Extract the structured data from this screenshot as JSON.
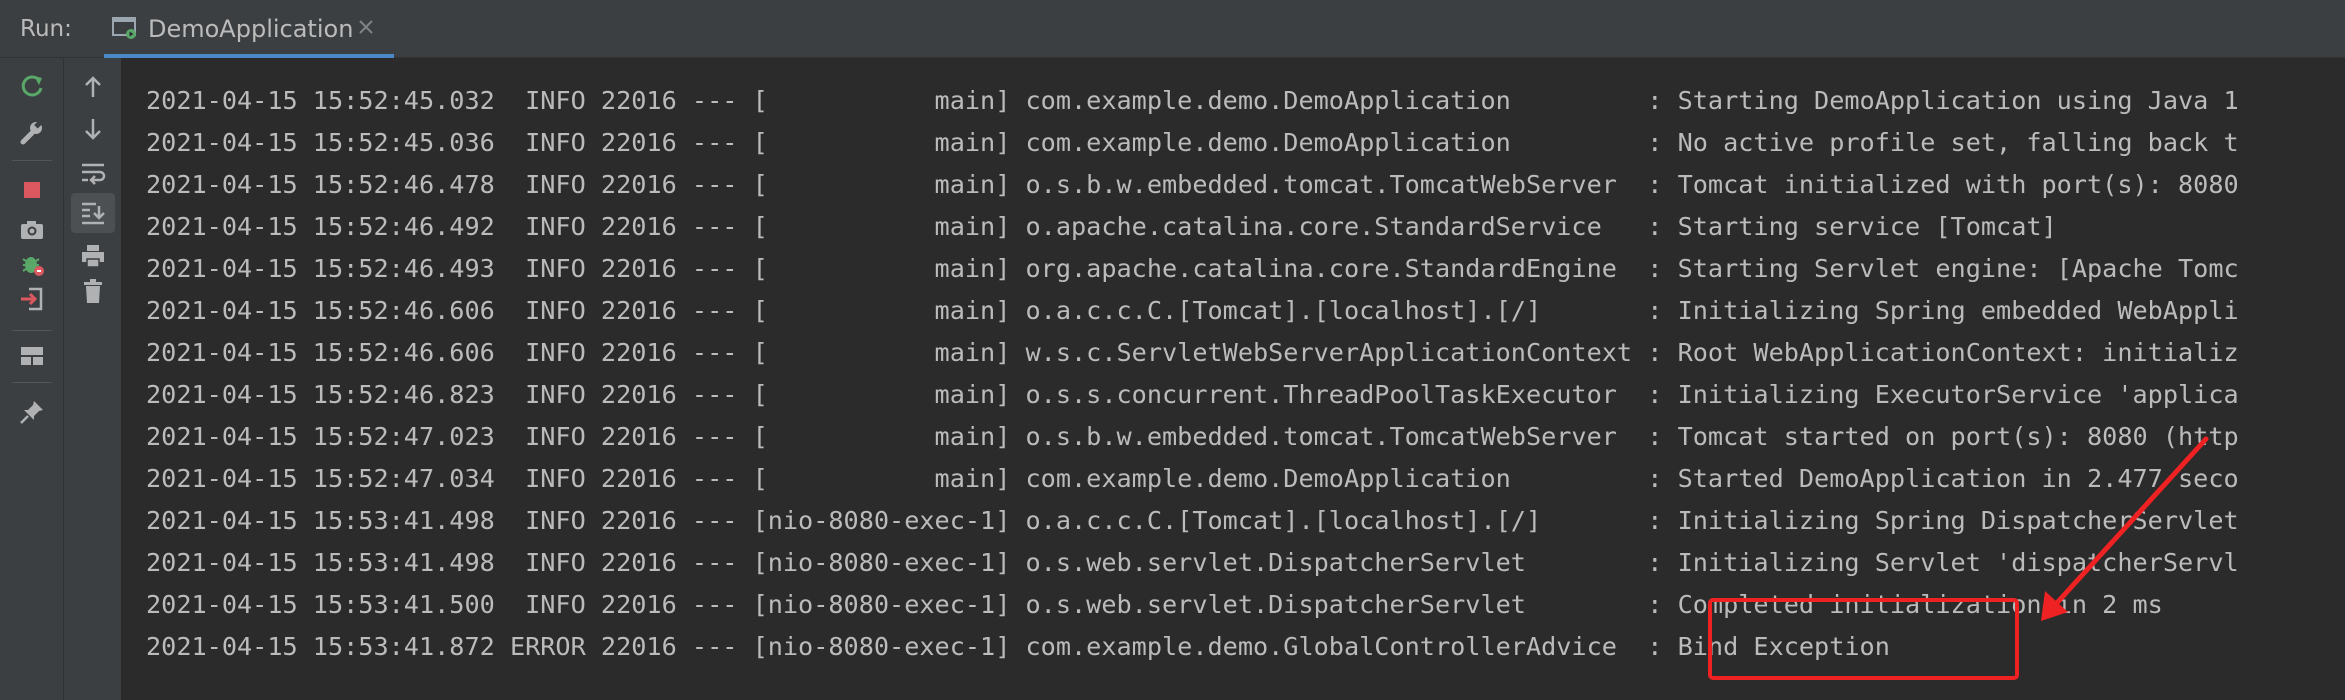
{
  "header": {
    "run_label": "Run:",
    "tab_label": "DemoApplication"
  },
  "toolbar": {
    "left": [
      {
        "name": "rerun-icon"
      },
      {
        "name": "wrench-icon"
      },
      {
        "name": "stop-icon"
      },
      {
        "name": "camera-icon"
      },
      {
        "name": "debug-icon"
      },
      {
        "name": "exit-icon"
      },
      {
        "name": "layout-icon"
      },
      {
        "name": "pin-icon"
      }
    ],
    "right": [
      {
        "name": "arrow-up-icon"
      },
      {
        "name": "arrow-down-icon"
      },
      {
        "name": "soft-wrap-icon"
      },
      {
        "name": "scroll-to-end-icon"
      },
      {
        "name": "print-icon"
      },
      {
        "name": "trash-icon"
      }
    ]
  },
  "colors": {
    "accent": "#4a88c7",
    "annotation": "#ee2222",
    "run_green": "#59a869",
    "stop_red": "#db5860"
  },
  "console": {
    "lines": [
      "2021-04-15 15:52:45.032  INFO 22016 --- [           main] com.example.demo.DemoApplication         : Starting DemoApplication using Java 1",
      "2021-04-15 15:52:45.036  INFO 22016 --- [           main] com.example.demo.DemoApplication         : No active profile set, falling back t",
      "2021-04-15 15:52:46.478  INFO 22016 --- [           main] o.s.b.w.embedded.tomcat.TomcatWebServer  : Tomcat initialized with port(s): 8080",
      "2021-04-15 15:52:46.492  INFO 22016 --- [           main] o.apache.catalina.core.StandardService   : Starting service [Tomcat]",
      "2021-04-15 15:52:46.493  INFO 22016 --- [           main] org.apache.catalina.core.StandardEngine  : Starting Servlet engine: [Apache Tomc",
      "2021-04-15 15:52:46.606  INFO 22016 --- [           main] o.a.c.c.C.[Tomcat].[localhost].[/]       : Initializing Spring embedded WebAppli",
      "2021-04-15 15:52:46.606  INFO 22016 --- [           main] w.s.c.ServletWebServerApplicationContext : Root WebApplicationContext: initializ",
      "2021-04-15 15:52:46.823  INFO 22016 --- [           main] o.s.s.concurrent.ThreadPoolTaskExecutor  : Initializing ExecutorService 'applica",
      "2021-04-15 15:52:47.023  INFO 22016 --- [           main] o.s.b.w.embedded.tomcat.TomcatWebServer  : Tomcat started on port(s): 8080 (http",
      "2021-04-15 15:52:47.034  INFO 22016 --- [           main] com.example.demo.DemoApplication         : Started DemoApplication in 2.477 seco",
      "2021-04-15 15:53:41.498  INFO 22016 --- [nio-8080-exec-1] o.a.c.c.C.[Tomcat].[localhost].[/]       : Initializing Spring DispatcherServlet",
      "2021-04-15 15:53:41.498  INFO 22016 --- [nio-8080-exec-1] o.s.web.servlet.DispatcherServlet        : Initializing Servlet 'dispatcherServl",
      "2021-04-15 15:53:41.500  INFO 22016 --- [nio-8080-exec-1] o.s.web.servlet.DispatcherServlet        : Completed initialization in 2 ms",
      "2021-04-15 15:53:41.872 ERROR 22016 --- [nio-8080-exec-1] com.example.demo.GlobalControllerAdvice  : Bind Exception"
    ]
  }
}
